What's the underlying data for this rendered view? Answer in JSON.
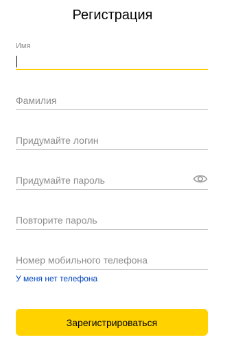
{
  "form": {
    "title": "Регистрация",
    "fields": {
      "first_name": {
        "label": "Имя",
        "value": ""
      },
      "last_name": {
        "placeholder": "Фамилия"
      },
      "login": {
        "placeholder": "Придумайте логин"
      },
      "password": {
        "placeholder": "Придумайте пароль"
      },
      "password_repeat": {
        "placeholder": "Повторите пароль"
      },
      "phone": {
        "placeholder": "Номер мобильного телефона"
      }
    },
    "no_phone_link": "У меня нет телефона",
    "submit_label": "Зарегистрироваться"
  },
  "icons": {
    "password_toggle": "eye-icon"
  },
  "colors": {
    "accent": "#ffcc00",
    "button": "#ffd200",
    "link": "#0044bb",
    "underline": "#c4c4c4",
    "placeholder": "#8c8c8c"
  }
}
